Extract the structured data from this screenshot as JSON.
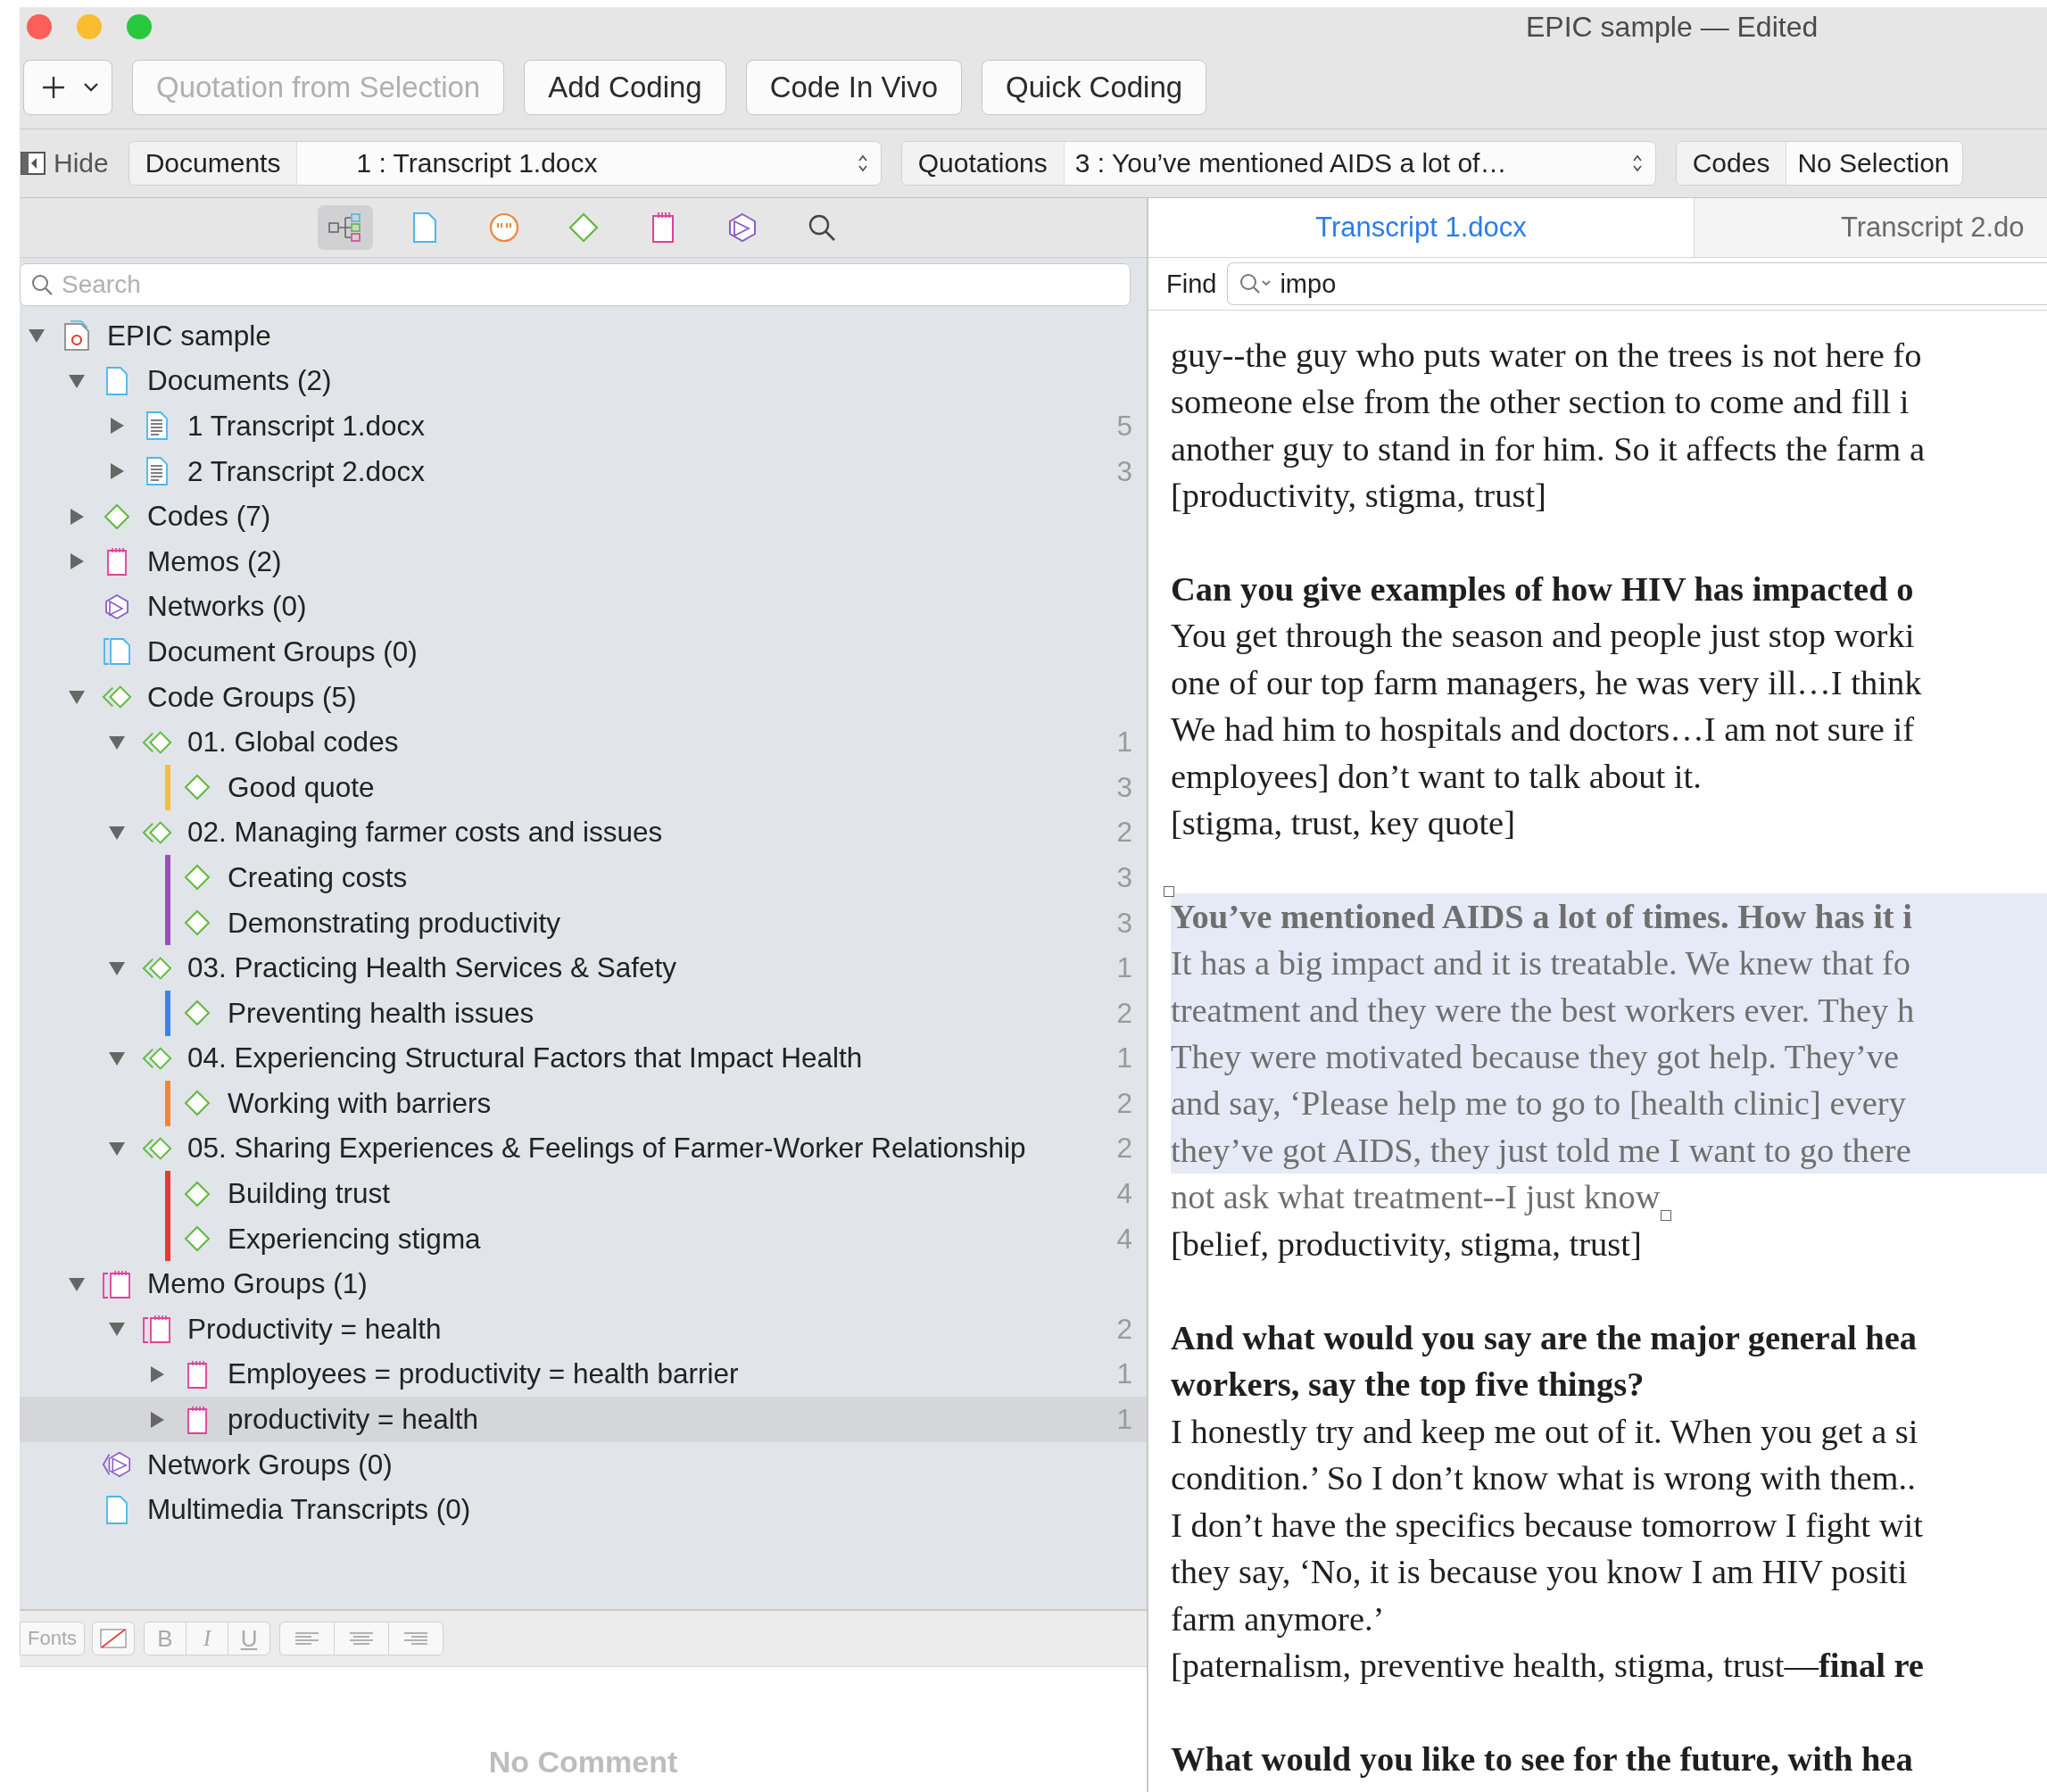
{
  "window": {
    "title": "EPIC sample — Edited"
  },
  "toolbar": {
    "buttons": [
      {
        "label": "Quotation from Selection",
        "disabled": true
      },
      {
        "label": "Add Coding",
        "disabled": false
      },
      {
        "label": "Code In Vivo",
        "disabled": false
      },
      {
        "label": "Quick Coding",
        "disabled": false
      }
    ]
  },
  "navigator": {
    "hide_label": "Hide",
    "selectors": [
      {
        "label": "Documents",
        "value": "1 : Transcript 1.docx",
        "stepper": true
      },
      {
        "label": "Quotations",
        "value": "3 : You’ve mentioned AIDS a lot of…",
        "stepper": true
      },
      {
        "label": "Codes",
        "value": "No Selection",
        "stepper": false
      }
    ]
  },
  "browser": {
    "tools": [
      {
        "kind": "tree",
        "selected": true
      },
      {
        "kind": "document",
        "selected": false
      },
      {
        "kind": "quotation",
        "selected": false
      },
      {
        "kind": "code",
        "selected": false
      },
      {
        "kind": "memo",
        "selected": false
      },
      {
        "kind": "network",
        "selected": false
      },
      {
        "kind": "search",
        "selected": false
      }
    ],
    "search": {
      "placeholder": "Search"
    },
    "tree": [
      {
        "label": "EPIC sample",
        "kind": "project",
        "expanded": true,
        "selected": false,
        "children": [
          {
            "label": "Documents (2)",
            "kind": "document",
            "expanded": true,
            "selected": false,
            "children": [
              {
                "label": "1  Transcript 1.docx",
                "kind": "text-document",
                "expanded": false,
                "selected": false,
                "count": "5"
              },
              {
                "label": "2  Transcript 2.docx",
                "kind": "text-document",
                "expanded": false,
                "selected": false,
                "count": "3"
              }
            ]
          },
          {
            "label": "Codes (7)",
            "kind": "code",
            "expanded": false,
            "selected": false
          },
          {
            "label": "Memos (2)",
            "kind": "memo",
            "expanded": false,
            "selected": false
          },
          {
            "label": "Networks (0)",
            "kind": "network",
            "selected": false
          },
          {
            "label": "Document Groups (0)",
            "kind": "document-group",
            "selected": false
          },
          {
            "label": "Code Groups (5)",
            "kind": "code-group",
            "expanded": true,
            "selected": false,
            "children": [
              {
                "label": "01. Global codes",
                "kind": "code-group",
                "expanded": true,
                "selected": false,
                "count": "1",
                "children": [
                  {
                    "label": "Good quote",
                    "kind": "code",
                    "selected": false,
                    "count": "3",
                    "color": "#f5bd41"
                  }
                ]
              },
              {
                "label": "02. Managing farmer costs and issues",
                "kind": "code-group",
                "expanded": true,
                "selected": false,
                "count": "2",
                "children": [
                  {
                    "label": "Creating costs",
                    "kind": "code",
                    "selected": false,
                    "count": "3",
                    "color": "#9b4dbb"
                  },
                  {
                    "label": "Demonstrating productivity",
                    "kind": "code",
                    "selected": false,
                    "count": "3",
                    "color": "#9b4dbb"
                  }
                ]
              },
              {
                "label": "03. Practicing Health Services & Safety",
                "kind": "code-group",
                "expanded": true,
                "selected": false,
                "count": "1",
                "children": [
                  {
                    "label": "Preventing health issues",
                    "kind": "code",
                    "selected": false,
                    "count": "2",
                    "color": "#3b82f0"
                  }
                ]
              },
              {
                "label": "04. Experiencing Structural Factors that Impact Health",
                "kind": "code-group",
                "expanded": true,
                "selected": false,
                "count": "1",
                "children": [
                  {
                    "label": "Working with barriers",
                    "kind": "code",
                    "selected": false,
                    "count": "2",
                    "color": "#f0863a"
                  }
                ]
              },
              {
                "label": "05. Sharing Experiences & Feelings of Farmer-Worker Relationship",
                "kind": "code-group",
                "expanded": true,
                "selected": false,
                "count": "2",
                "children": [
                  {
                    "label": "Building trust",
                    "kind": "code",
                    "selected": false,
                    "count": "4",
                    "color": "#e53a32"
                  },
                  {
                    "label": "Experiencing stigma",
                    "kind": "code",
                    "selected": false,
                    "count": "4",
                    "color": "#e53a32"
                  }
                ]
              }
            ]
          },
          {
            "label": "Memo Groups (1)",
            "kind": "memo-group",
            "expanded": true,
            "selected": false,
            "children": [
              {
                "label": "Productivity = health",
                "kind": "memo-group",
                "expanded": true,
                "selected": false,
                "count": "2",
                "children": [
                  {
                    "label": "Employees = productivity = health barrier",
                    "kind": "memo",
                    "expanded": false,
                    "selected": false,
                    "count": "1"
                  },
                  {
                    "label": "productivity = health",
                    "kind": "memo",
                    "expanded": false,
                    "selected": true,
                    "count": "1"
                  }
                ]
              }
            ]
          },
          {
            "label": "Network Groups (0)",
            "kind": "network-group",
            "selected": false
          },
          {
            "label": "Multimedia Transcripts (0)",
            "kind": "document",
            "selected": false
          }
        ]
      }
    ],
    "format_bar": {
      "fonts": "Fonts",
      "styles": [
        "B",
        "I",
        "U"
      ]
    },
    "comment": {
      "text": "No Comment"
    }
  },
  "editor": {
    "tabs": [
      {
        "label": "Transcript 1.docx",
        "selected": true
      },
      {
        "label": "Transcript 2.do",
        "selected": false
      }
    ],
    "find": {
      "label": "Find",
      "value": "impo"
    },
    "blocks": [
      {
        "lines": [
          {
            "text": "guy--the guy who puts water on the trees is not here fo",
            "bold": false,
            "quoted": false,
            "highlighted": false
          },
          {
            "text": "someone else from the other section to come and fill i",
            "bold": false,
            "quoted": false,
            "highlighted": false
          },
          {
            "text": "another guy to stand in for him. So it affects the farm a",
            "bold": false,
            "quoted": false,
            "highlighted": false
          },
          {
            "text": "[productivity, stigma, trust]",
            "bold": false,
            "quoted": false,
            "highlighted": false
          }
        ]
      },
      {
        "lines": [
          {
            "text": "Can you give examples of how HIV has impacted o",
            "bold": true,
            "quoted": false,
            "highlighted": false
          },
          {
            "text": "You get through the season and people just stop worki",
            "bold": false,
            "quoted": false,
            "highlighted": false
          },
          {
            "text": "one of our top farm managers, he was very ill…I think",
            "bold": false,
            "quoted": false,
            "highlighted": false
          },
          {
            "text": "We had him to hospitals and doctors…I am not sure if",
            "bold": false,
            "quoted": false,
            "highlighted": false
          },
          {
            "text": "employees] don’t want to talk about it.",
            "bold": false,
            "quoted": false,
            "highlighted": false
          },
          {
            "text": "[stigma, trust, key quote]",
            "bold": false,
            "quoted": false,
            "highlighted": false
          }
        ]
      },
      {
        "lines": [
          {
            "text": "You’ve mentioned AIDS a lot of times. How has it i",
            "bold": true,
            "quoted": true,
            "highlighted": true
          },
          {
            "text": "It has a big impact and it is treatable. We knew that fo",
            "bold": false,
            "quoted": true,
            "highlighted": true
          },
          {
            "text": "treatment and they were the best workers ever. They h",
            "bold": false,
            "quoted": true,
            "highlighted": true
          },
          {
            "text": "They were motivated because they got help. They’ve",
            "bold": false,
            "quoted": true,
            "highlighted": true
          },
          {
            "text": "and say, ‘Please help me to go to [health clinic] every",
            "bold": false,
            "quoted": true,
            "highlighted": true
          },
          {
            "text": "they’ve got AIDS, they just told me I want to go there",
            "bold": false,
            "quoted": true,
            "highlighted": true
          },
          {
            "text": "not ask what treatment--I just know",
            "bold": false,
            "quoted": true,
            "highlighted": false
          },
          {
            "text": "[belief, productivity, stigma, trust]",
            "bold": false,
            "quoted": false,
            "highlighted": false
          }
        ]
      },
      {
        "lines": [
          {
            "text": "And what would you say are the major general hea",
            "bold": true,
            "quoted": false,
            "highlighted": false
          },
          {
            "text": "workers, say the top five things?",
            "bold": true,
            "quoted": false,
            "highlighted": false
          },
          {
            "text": "I honestly try and keep me out of it. When you get a si",
            "bold": false,
            "quoted": false,
            "highlighted": false
          },
          {
            "text": "condition.’ So I don’t know what is wrong with them..",
            "bold": false,
            "quoted": false,
            "highlighted": false
          },
          {
            "text": "I don’t have the specifics because tomorrow I fight wit",
            "bold": false,
            "quoted": false,
            "highlighted": false
          },
          {
            "text": "they say, ‘No, it is because you know I am HIV positi",
            "bold": false,
            "quoted": false,
            "highlighted": false
          },
          {
            "text": "farm anymore.’",
            "bold": false,
            "quoted": false,
            "highlighted": false
          },
          {
            "text": "[paternalism, preventive health, stigma, trust—**final re**",
            "bold": false,
            "quoted": false,
            "highlighted": false
          }
        ]
      },
      {
        "lines": [
          {
            "text": "What would you like to see for the future, with hea",
            "bold": true,
            "quoted": false,
            "highlighted": false
          }
        ]
      }
    ]
  }
}
